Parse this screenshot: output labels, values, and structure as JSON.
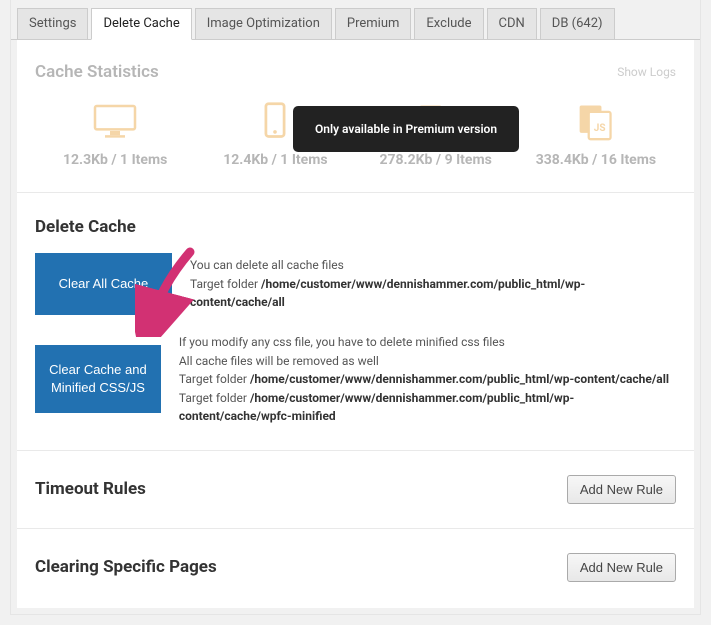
{
  "tabs": [
    {
      "label": "Settings",
      "active": false
    },
    {
      "label": "Delete Cache",
      "active": true
    },
    {
      "label": "Image Optimization",
      "active": false
    },
    {
      "label": "Premium",
      "active": false
    },
    {
      "label": "Exclude",
      "active": false
    },
    {
      "label": "CDN",
      "active": false
    },
    {
      "label": "DB (642)",
      "active": false
    }
  ],
  "stats": {
    "title": "Cache Statistics",
    "show_logs": "Show Logs",
    "tooltip": "Only available in Premium version",
    "items": [
      {
        "icon": "desktop",
        "value": "12.3Kb / 1 Items"
      },
      {
        "icon": "mobile",
        "value": "12.4Kb / 1 Items"
      },
      {
        "icon": "css",
        "value": "278.2Kb / 9 Items"
      },
      {
        "icon": "js",
        "value": "338.4Kb / 16 Items"
      }
    ]
  },
  "delete_cache": {
    "heading": "Delete Cache",
    "clear_all": {
      "label": "Clear All Cache",
      "desc": "You can delete all cache files",
      "target_prefix": "Target folder ",
      "target_path": "/home/customer/www/dennishammer.com/public_html/wp-content/cache/all"
    },
    "clear_min": {
      "label": "Clear Cache and Minified CSS/JS",
      "line1": "If you modify any css file, you have to delete minified css files",
      "line2": "All cache files will be removed as well",
      "target_prefix": "Target folder ",
      "target_path1": "/home/customer/www/dennishammer.com/public_html/wp-content/cache/all",
      "target_path2": "/home/customer/www/dennishammer.com/public_html/wp-content/cache/wpfc-minified"
    }
  },
  "timeout": {
    "heading": "Timeout Rules",
    "btn": "Add New Rule"
  },
  "clearing": {
    "heading": "Clearing Specific Pages",
    "btn": "Add New Rule"
  }
}
